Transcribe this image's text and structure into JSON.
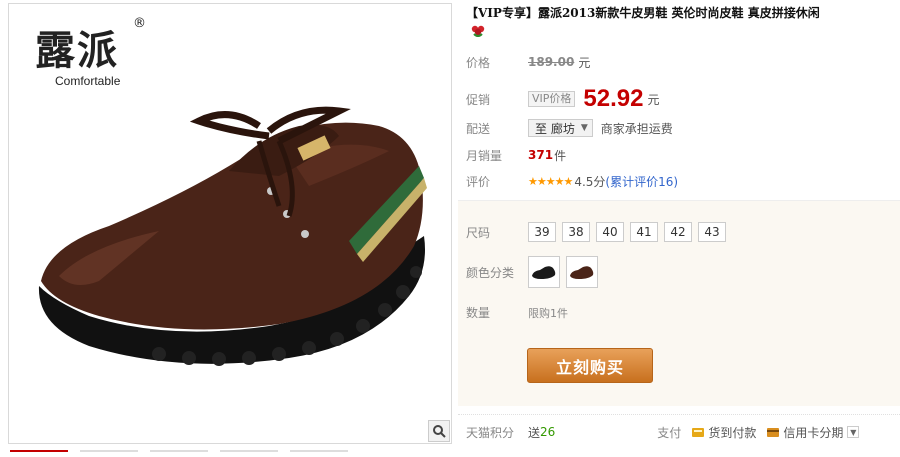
{
  "brand": {
    "name_zh": "露派",
    "registered_mark": "®",
    "tagline": "Comfortable"
  },
  "product": {
    "title": "【VIP专享】露派2013新款牛皮男鞋 英伦时尚皮鞋 真皮拼接休闲"
  },
  "price": {
    "label": "价格",
    "original": "189.00",
    "unit": "元"
  },
  "promo": {
    "label": "促销",
    "badge": "VIP价格",
    "price": "52.92",
    "unit": "元"
  },
  "shipping": {
    "label": "配送",
    "selected": "至 廊坊",
    "note": "商家承担运费"
  },
  "sales": {
    "label": "月销量",
    "count": "371",
    "unit": "件"
  },
  "rating": {
    "label": "评价",
    "stars": 4.5,
    "star_glyphs": "★★★★★",
    "score": "4.5分",
    "review_link": "(累计评价16)"
  },
  "size": {
    "label": "尺码",
    "options": [
      "39",
      "38",
      "40",
      "41",
      "42",
      "43"
    ]
  },
  "color": {
    "label": "颜色分类",
    "options": [
      "black-shoe",
      "brown-shoe"
    ]
  },
  "quantity": {
    "label": "数量",
    "limit_text": "限购1件"
  },
  "buy_button": {
    "label": "立刻购买",
    "color": "#d9822b"
  },
  "footer": {
    "points_label": "天猫积分",
    "points_prefix": "送",
    "points_value": "26",
    "pay_label": "支付",
    "pay_options": [
      "货到付款",
      "信用卡分期"
    ]
  },
  "colors": {
    "price_red": "#c40000",
    "link_blue": "#3366cc",
    "star_orange": "#ff9900",
    "points_green": "#339900"
  }
}
